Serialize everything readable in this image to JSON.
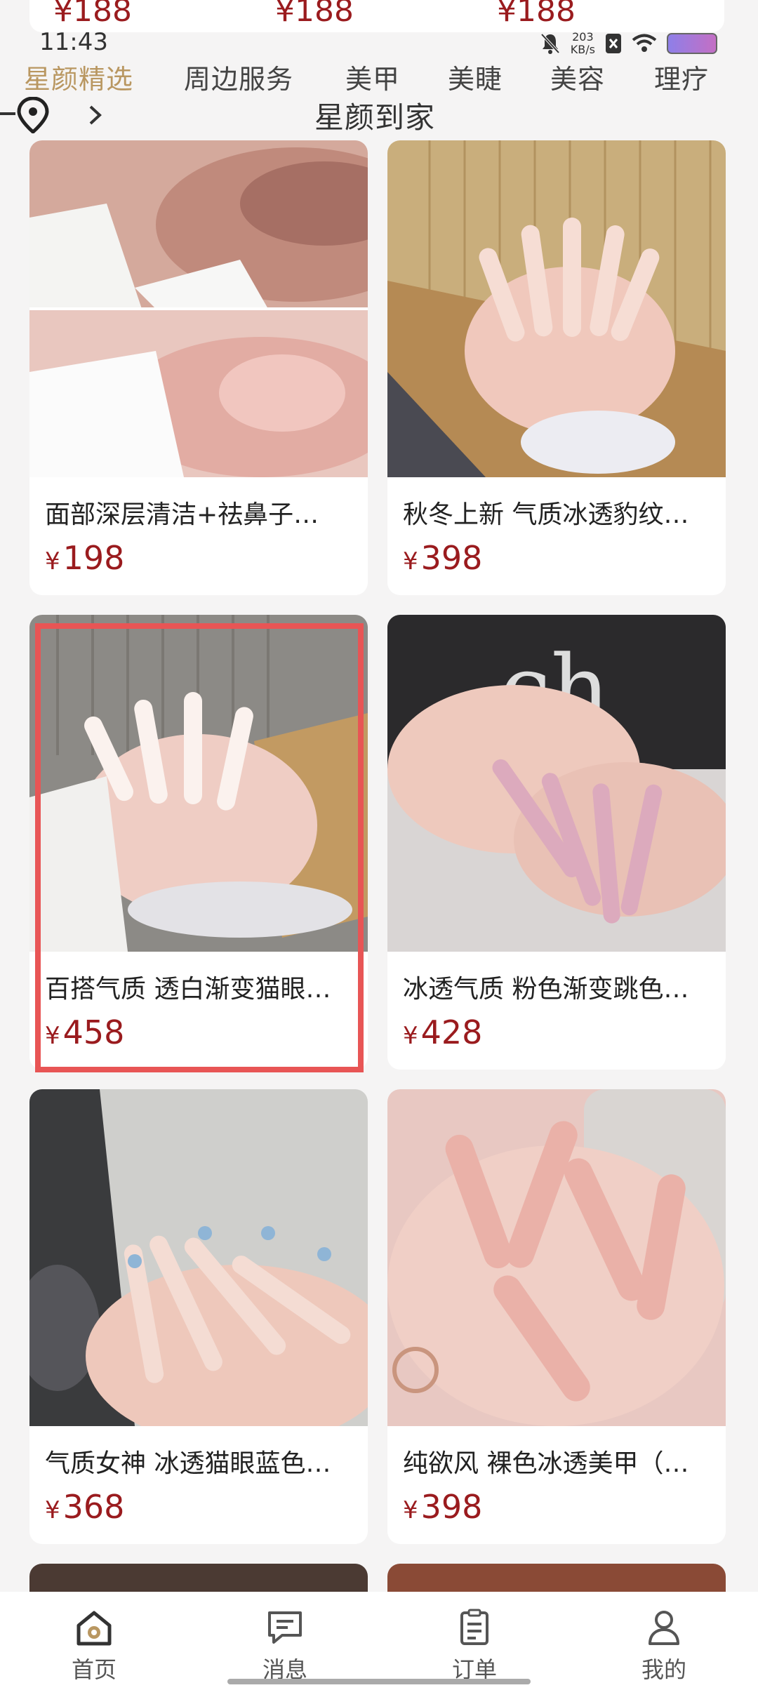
{
  "status": {
    "time": "11:43",
    "speed_value": "203",
    "speed_unit": "KB/s"
  },
  "tabs": [
    "星颜精选",
    "周边服务",
    "美甲",
    "美睫",
    "美容",
    "理疗"
  ],
  "location_title": "星颜到家",
  "top_prices": [
    "¥188",
    "¥188",
    "¥188"
  ],
  "products": [
    {
      "title": "面部深层清洁+祛鼻子…",
      "price": "198"
    },
    {
      "title": "秋冬上新 气质冰透豹纹…",
      "price": "398"
    },
    {
      "title": "百搭气质 透白渐变猫眼…",
      "price": "458"
    },
    {
      "title": "冰透气质 粉色渐变跳色…",
      "price": "428"
    },
    {
      "title": "气质女神 冰透猫眼蓝色…",
      "price": "368"
    },
    {
      "title": "纯欲风 裸色冰透美甲（…",
      "price": "398"
    }
  ],
  "bottom_nav": [
    "首页",
    "消息",
    "订单",
    "我的"
  ],
  "colors": {
    "accent": "#b99761",
    "price": "#9a1b1e",
    "highlight": "#e85555"
  }
}
